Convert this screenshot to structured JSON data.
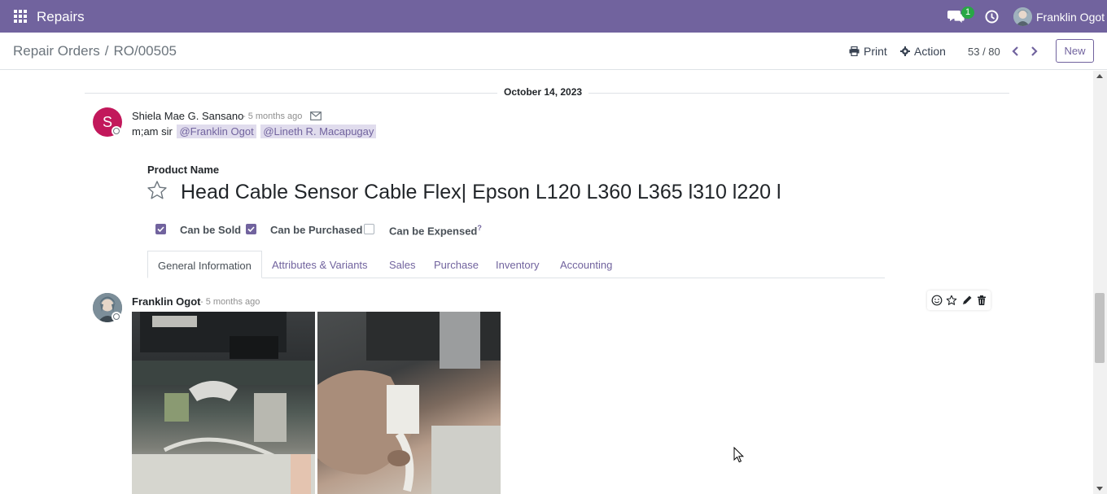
{
  "navbar": {
    "app_name": "Repairs",
    "chat_badge": "1",
    "user_name": "Franklin Ogot",
    "bg_color": "#71639e"
  },
  "control": {
    "breadcrumb_parent": "Repair Orders",
    "breadcrumb_separator": "/",
    "breadcrumb_current": "RO/00505",
    "print_label": "Print",
    "action_label": "Action",
    "pager": "53 / 80",
    "new_label": "New"
  },
  "chatter": {
    "date_separator": "October 14, 2023",
    "message1": {
      "avatar_letter": "S",
      "author": "Shiela Mae G. Sansano",
      "date": "- 5 months ago",
      "body_text": "m;am sir",
      "mentions": [
        "@Franklin Ogot",
        "@Lineth R. Macapugay"
      ]
    },
    "message2": {
      "author": "Franklin Ogot",
      "date": "- 5 months ago"
    }
  },
  "product": {
    "field_label": "Product Name",
    "name": "Head Cable Sensor Cable Flex|  Epson L120 L360 L365 l310 l220 l",
    "checkboxes": [
      {
        "label": "Can be Sold",
        "checked": true
      },
      {
        "label": "Can be Purchased",
        "checked": true
      },
      {
        "label": "Can be Expensed",
        "checked": false,
        "help": "?"
      }
    ],
    "tabs": [
      "General Information",
      "Attributes & Variants",
      "Sales",
      "Purchase",
      "Inventory",
      "Accounting"
    ]
  },
  "icons": {
    "apps": "apps-grid-icon",
    "chat": "chat-icon",
    "clock": "clock-icon",
    "print": "print-icon",
    "action": "gear-icon",
    "mail": "envelope-icon",
    "star": "star-icon"
  }
}
